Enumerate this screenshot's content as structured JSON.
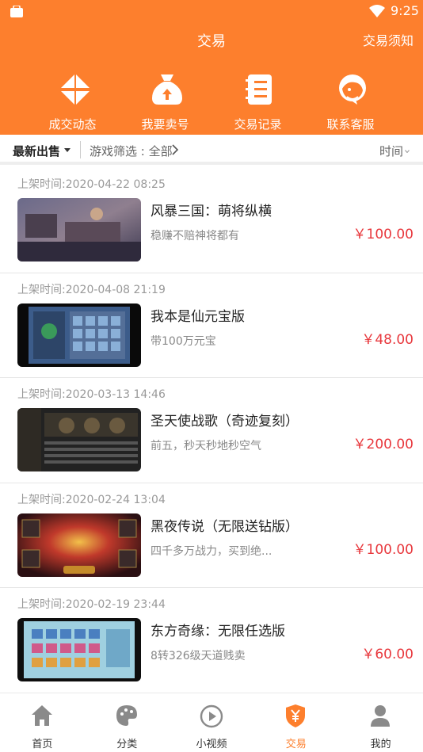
{
  "status_bar": {
    "time": "9:25"
  },
  "header": {
    "title": "交易",
    "notice": "交易须知"
  },
  "quick_actions": [
    {
      "label": "成交动态",
      "icon": "deal-activity-icon"
    },
    {
      "label": "我要卖号",
      "icon": "sell-account-bag-icon"
    },
    {
      "label": "交易记录",
      "icon": "trade-record-icon"
    },
    {
      "label": "联系客服",
      "icon": "customer-service-icon"
    }
  ],
  "filter": {
    "sort_label": "最新出售",
    "game_filter": "游戏筛选 : 全部",
    "time_label": "时间"
  },
  "listings": [
    {
      "time": "上架时间:2020-04-22 08:25",
      "title": "风暴三国：萌将纵横",
      "desc": "稳赚不赔神将都有",
      "price": "￥100.00",
      "thumb": "thumb-sanguo"
    },
    {
      "time": "上架时间:2020-04-08 21:19",
      "title": "我本是仙元宝版",
      "desc": "带100万元宝",
      "price": "￥48.00",
      "thumb": "thumb-xian"
    },
    {
      "time": "上架时间:2020-03-13 14:46",
      "title": "圣天使战歌（奇迹复刻）",
      "desc": "前五，秒天秒地秒空气",
      "price": "￥200.00",
      "thumb": "thumb-angel"
    },
    {
      "time": "上架时间:2020-02-24 13:04",
      "title": "黑夜传说（无限送钻版）",
      "desc": "四千多万战力，买到绝...",
      "price": "￥100.00",
      "thumb": "thumb-night"
    },
    {
      "time": "上架时间:2020-02-19 23:44",
      "title": "东方奇缘：无限任选版",
      "desc": "8转326级天道贱卖",
      "price": "￥60.00",
      "thumb": "thumb-east"
    }
  ],
  "tabs": [
    {
      "label": "首页",
      "icon": "home-icon"
    },
    {
      "label": "分类",
      "icon": "palette-icon"
    },
    {
      "label": "小视频",
      "icon": "play-video-icon"
    },
    {
      "label": "交易",
      "icon": "trade-shield-icon",
      "active": true
    },
    {
      "label": "我的",
      "icon": "user-icon"
    }
  ],
  "colors": {
    "brand": "#fd7f2d",
    "price": "#e8383d"
  }
}
